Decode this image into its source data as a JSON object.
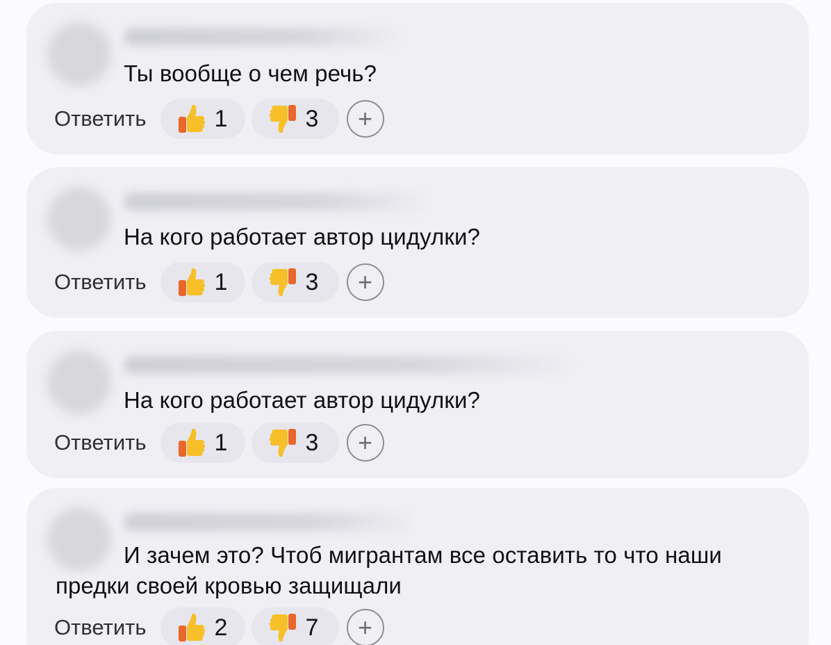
{
  "comments": [
    {
      "text": "Ты вообще о чем речь?",
      "reply_label": "Ответить",
      "likes": "1",
      "dislikes": "3",
      "add_reaction_label": "+"
    },
    {
      "text": "На кого работает автор цидулки?",
      "reply_label": "Ответить",
      "likes": "1",
      "dislikes": "3",
      "add_reaction_label": "+"
    },
    {
      "text": "На кого работает автор цидулки?",
      "reply_label": "Ответить",
      "likes": "1",
      "dislikes": "3",
      "add_reaction_label": "+"
    },
    {
      "text": "И зачем это? Чтоб мигрантам все оставить то что наши предки своей кровью защищали",
      "reply_label": "Ответить",
      "likes": "2",
      "dislikes": "7",
      "add_reaction_label": "+"
    }
  ],
  "icons": {
    "like": "thumbs-up-icon",
    "dislike": "thumbs-down-icon",
    "add": "plus-icon"
  },
  "colors": {
    "card_background": "#efeff4",
    "chip_background": "#e6e6ec",
    "thumb_yellow": "#f7c02a",
    "thumb_orange": "#e8672a"
  }
}
